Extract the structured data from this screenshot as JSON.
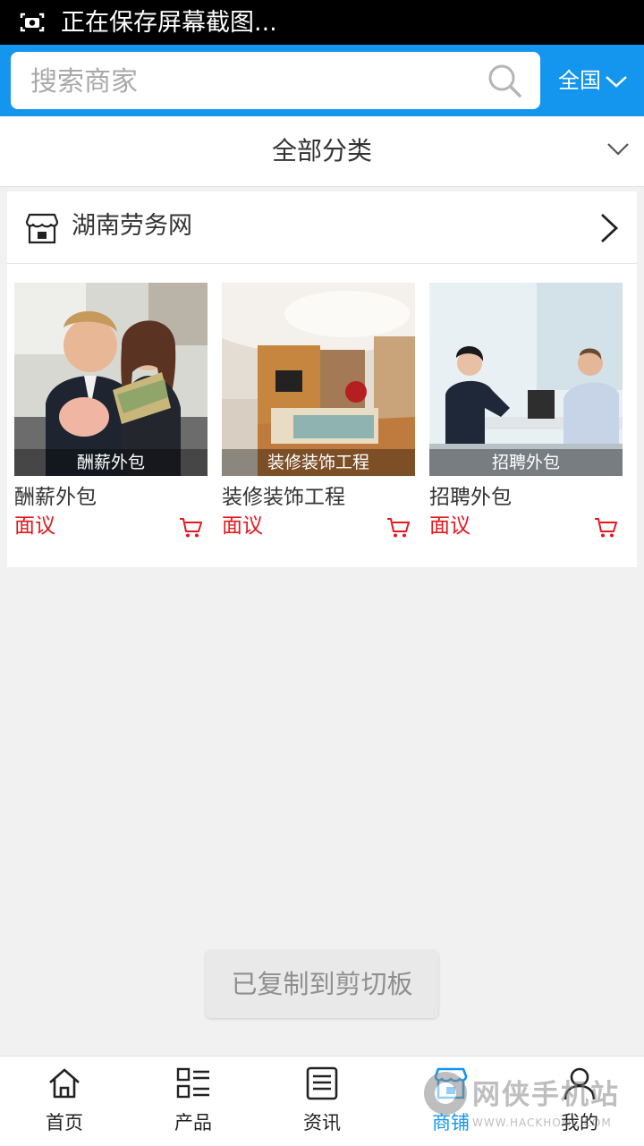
{
  "status_bar": {
    "text": "正在保存屏幕截图..."
  },
  "header": {
    "search_placeholder": "搜索商家",
    "region_label": "全国"
  },
  "category_bar": {
    "label": "全部分类"
  },
  "shop": {
    "name": "湖南劳务网",
    "products": [
      {
        "image_caption": "酬薪外包",
        "title": "酬薪外包",
        "price": "面议"
      },
      {
        "image_caption": "装修装饰工程",
        "title": "装修装饰工程",
        "price": "面议"
      },
      {
        "image_caption": "招聘外包",
        "title": "招聘外包",
        "price": "面议"
      }
    ]
  },
  "toast": {
    "text": "已复制到剪切板"
  },
  "tab_bar": {
    "tabs": [
      {
        "label": "首页",
        "icon": "home-icon"
      },
      {
        "label": "产品",
        "icon": "product-list-icon"
      },
      {
        "label": "资讯",
        "icon": "news-icon"
      },
      {
        "label": "商铺",
        "icon": "store-icon",
        "active": true
      },
      {
        "label": "我的",
        "icon": "user-icon"
      }
    ]
  },
  "watermark": {
    "line1": "网侠手机站",
    "line2": "WWW.HACKHOME.COM"
  },
  "colors": {
    "accent": "#1496ee",
    "price": "#e4181e"
  }
}
